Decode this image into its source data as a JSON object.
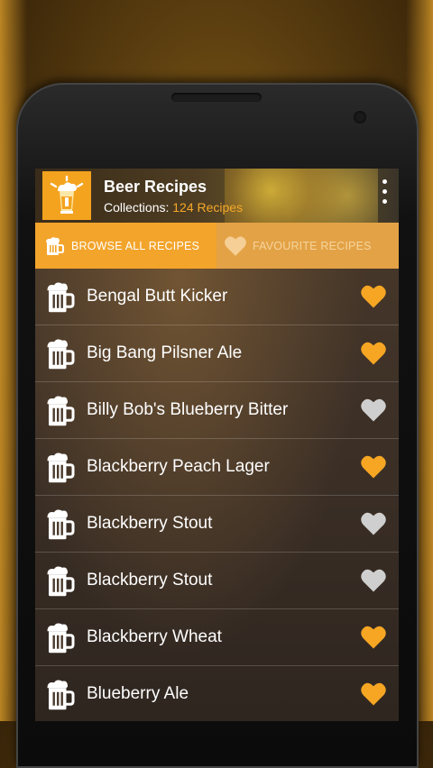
{
  "header": {
    "title": "Beer Recipes",
    "subtitle_label": "Collections:",
    "subtitle_count": "124 Recipes",
    "logo_icon": "beer-glass-icon",
    "menu_icon": "more-vert-icon"
  },
  "tabs": [
    {
      "label": "BROWSE ALL RECIPES",
      "icon": "beer-mug-icon",
      "active": true
    },
    {
      "label": "FAVOURITE RECIPES",
      "icon": "heart-icon",
      "active": false
    }
  ],
  "colors": {
    "accent": "#f3a42b",
    "heart_on": "#f6a623",
    "heart_off": "#cfcfcf"
  },
  "recipes": [
    {
      "name": "Bengal Butt Kicker",
      "favourite": true
    },
    {
      "name": "Big Bang Pilsner Ale",
      "favourite": true
    },
    {
      "name": "Billy Bob's Blueberry Bitter",
      "favourite": false
    },
    {
      "name": "Blackberry Peach Lager",
      "favourite": true
    },
    {
      "name": "Blackberry Stout",
      "favourite": false
    },
    {
      "name": "Blackberry Stout",
      "favourite": false
    },
    {
      "name": "Blackberry Wheat",
      "favourite": true
    },
    {
      "name": "Blueberry Ale",
      "favourite": true
    }
  ]
}
